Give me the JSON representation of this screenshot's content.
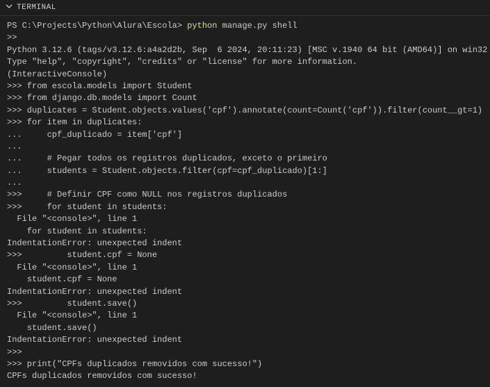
{
  "header": {
    "title": "TERMINAL"
  },
  "prompt": {
    "path": "PS C:\\Projects\\Python\\Alura\\Escola> ",
    "cmd_python": "python",
    "cmd_rest": " manage.py shell"
  },
  "lines": {
    "l1": ">>",
    "l2": "Python 3.12.6 (tags/v3.12.6:a4a2d2b, Sep  6 2024, 20:11:23) [MSC v.1940 64 bit (AMD64)] on win32",
    "l3": "Type \"help\", \"copyright\", \"credits\" or \"license\" for more information.",
    "l4": "(InteractiveConsole)",
    "l5": ">>> from escola.models import Student",
    "l6": ">>> from django.db.models import Count",
    "l7": ">>> duplicates = Student.objects.values('cpf').annotate(count=Count('cpf')).filter(count__gt=1)",
    "l8": ">>> for item in duplicates:",
    "l9": "...     cpf_duplicado = item['cpf']",
    "l10": "...",
    "l11": "...     # Pegar todos os registros duplicados, exceto o primeiro",
    "l12": "...     students = Student.objects.filter(cpf=cpf_duplicado)[1:]",
    "l13": "...",
    "l14": ">>>     # Definir CPF como NULL nos registros duplicados",
    "l15": ">>>     for student in students:",
    "l16": "  File \"<console>\", line 1",
    "l17": "    for student in students:",
    "l18": "IndentationError: unexpected indent",
    "l19": ">>>         student.cpf = None",
    "l20": "  File \"<console>\", line 1",
    "l21": "    student.cpf = None",
    "l22": "IndentationError: unexpected indent",
    "l23": ">>>         student.save()",
    "l24": "  File \"<console>\", line 1",
    "l25": "    student.save()",
    "l26": "IndentationError: unexpected indent",
    "l27": ">>>",
    "l28": ">>> print(\"CPFs duplicados removidos com sucesso!\")",
    "l29": "CPFs duplicados removidos com sucesso!"
  }
}
